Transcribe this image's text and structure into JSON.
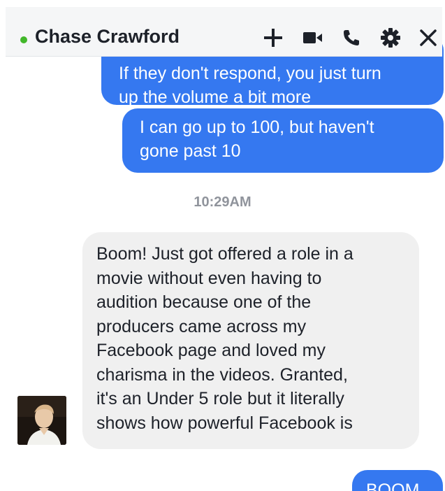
{
  "header": {
    "contact_name": "Chase Crawford",
    "presence": "online",
    "presence_color": "#42b72a",
    "icons": [
      "plus-icon",
      "video-camera-icon",
      "phone-icon",
      "gear-icon",
      "close-icon"
    ]
  },
  "messages": [
    {
      "direction": "sent",
      "lines": [
        "If they don't respond, you just turn",
        "up the volume a bit more"
      ]
    },
    {
      "direction": "sent",
      "lines": [
        "I can go up to 100, but haven't",
        "gone past 10"
      ]
    },
    {
      "direction": "received",
      "lines": [
        "Boom! Just got offered a role in a",
        "movie without even having to",
        "audition because one of the",
        "producers came across my",
        "Facebook page and loved my",
        "charisma in the videos. Granted,",
        "it's an Under 5 role but it literally",
        "shows how powerful Facebook is"
      ]
    },
    {
      "direction": "sent",
      "lines": [
        "BOOM"
      ]
    }
  ],
  "timestamp": "10:29AM",
  "colors": {
    "sent_bubble": "#3578f0",
    "received_bubble": "#f0f0f0",
    "header_bg": "#f5f6f7"
  }
}
